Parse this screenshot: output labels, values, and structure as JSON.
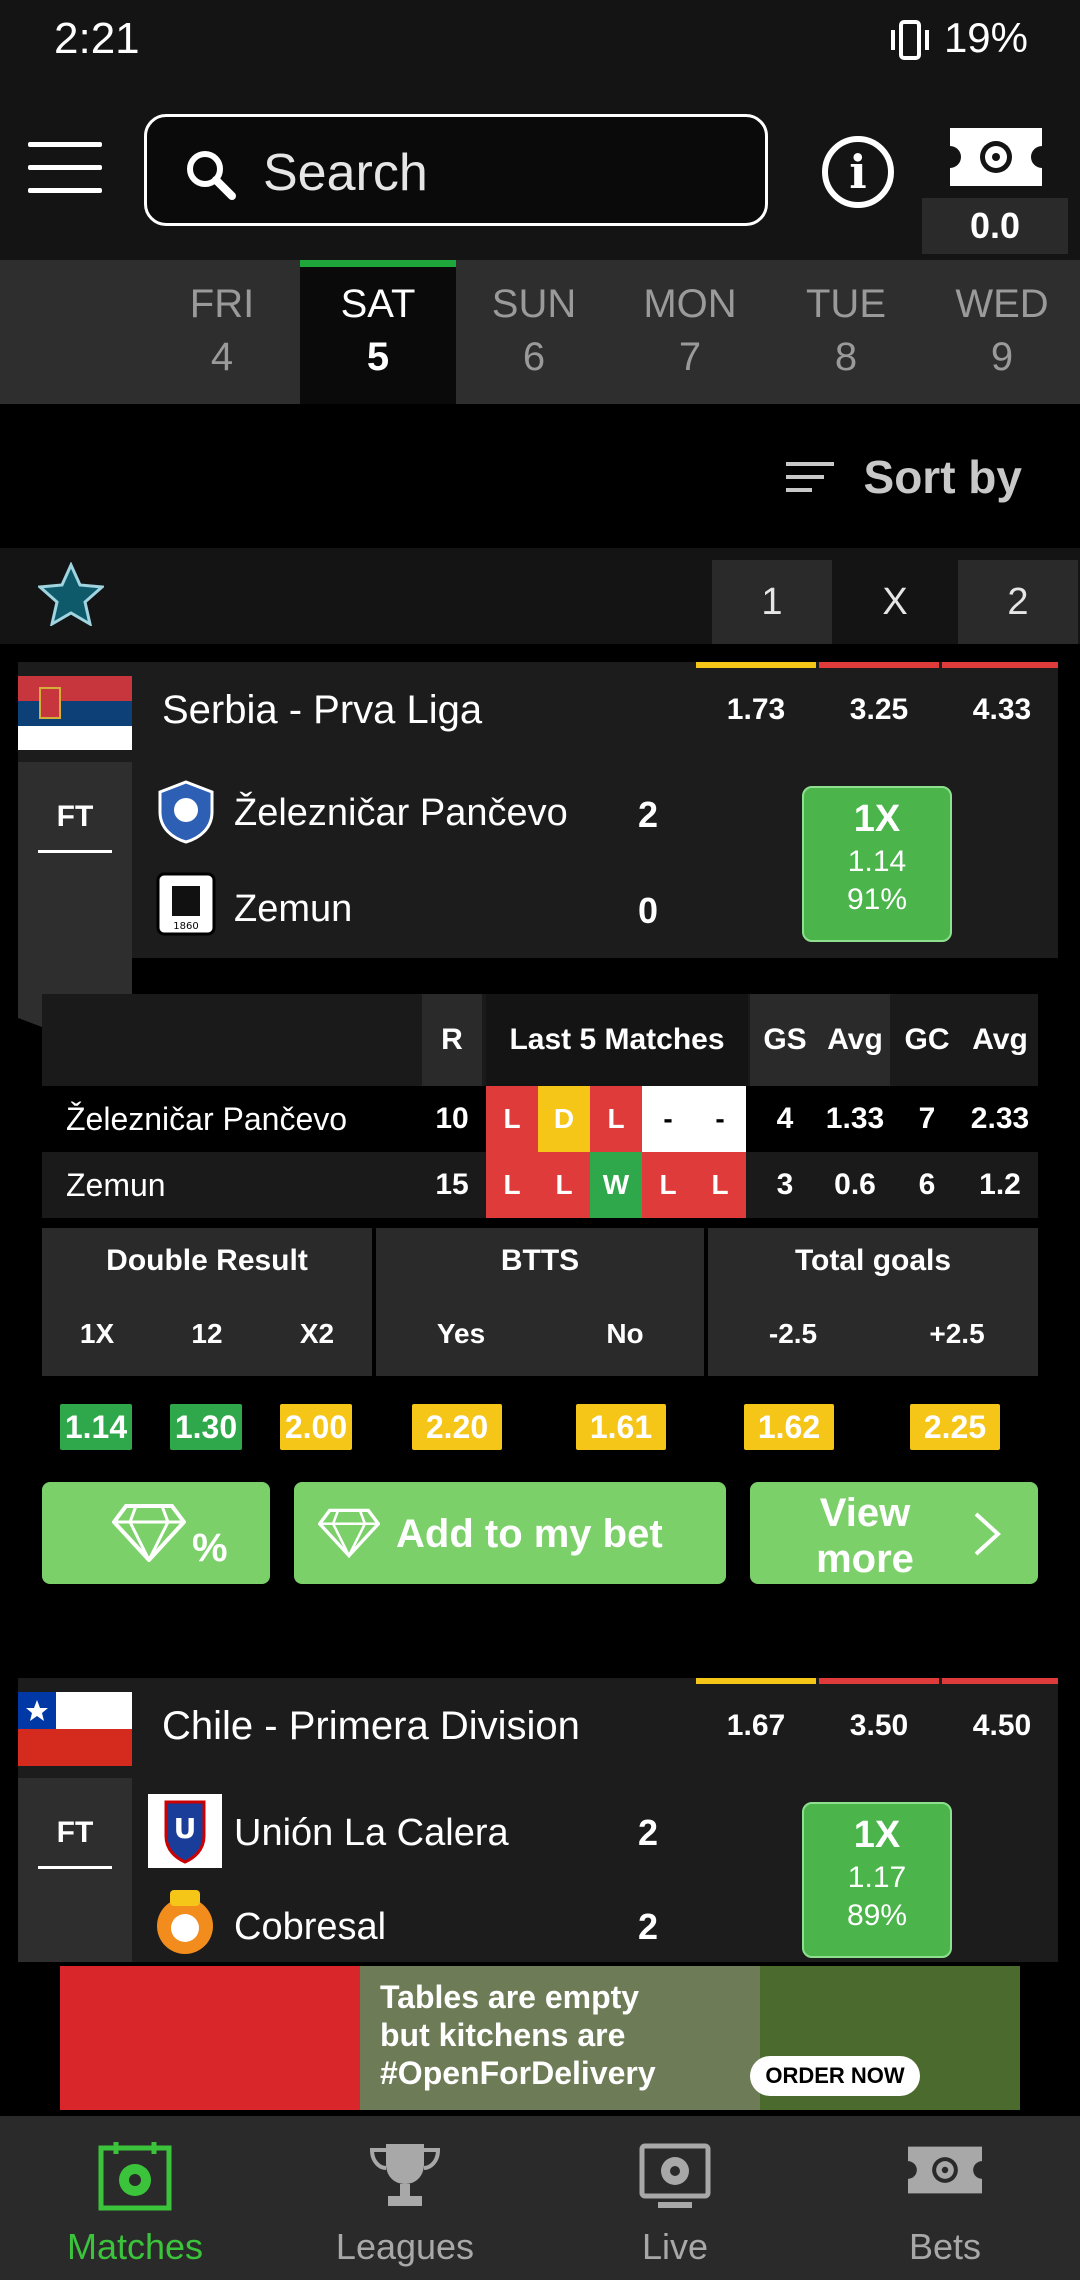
{
  "status": {
    "time": "2:21",
    "battery": "19%"
  },
  "search": {
    "placeholder": "Search"
  },
  "betslip": {
    "count": "0.0"
  },
  "days": [
    {
      "name": "FRI",
      "num": "4"
    },
    {
      "name": "SAT",
      "num": "5"
    },
    {
      "name": "SUN",
      "num": "6"
    },
    {
      "name": "MON",
      "num": "7"
    },
    {
      "name": "TUE",
      "num": "8"
    },
    {
      "name": "WED",
      "num": "9"
    }
  ],
  "sort": {
    "label": "Sort by"
  },
  "header_cols": [
    "1",
    "X",
    "2"
  ],
  "match1": {
    "league": "Serbia - Prva Liga",
    "odds": [
      "1.73",
      "3.25",
      "4.33"
    ],
    "status": "FT",
    "home": {
      "name": "Železničar Pančevo",
      "score": "2"
    },
    "away": {
      "name": "Zemun",
      "score": "0"
    },
    "tip": {
      "pick": "1X",
      "odd": "1.14",
      "pct": "91%"
    },
    "stats": {
      "headers": {
        "r": "R",
        "last5": "Last 5 Matches",
        "gs": "GS",
        "avg1": "Avg",
        "gc": "GC",
        "avg2": "Avg"
      },
      "rows": [
        {
          "team": "Železničar Pančevo",
          "r": "10",
          "form": [
            "L",
            "D",
            "L",
            "-",
            "-"
          ],
          "gs": "4",
          "avg1": "1.33",
          "gc": "7",
          "avg2": "2.33"
        },
        {
          "team": "Zemun",
          "r": "15",
          "form": [
            "L",
            "L",
            "W",
            "L",
            "L"
          ],
          "gs": "3",
          "avg1": "0.6",
          "gc": "6",
          "avg2": "1.2"
        }
      ]
    },
    "markets": {
      "double": {
        "title": "Double Result",
        "subs": [
          "1X",
          "12",
          "X2"
        ],
        "values": [
          "1.14",
          "1.30",
          "2.00"
        ]
      },
      "btts": {
        "title": "BTTS",
        "subs": [
          "Yes",
          "No"
        ],
        "values": [
          "2.20",
          "1.61"
        ]
      },
      "total": {
        "title": "Total goals",
        "subs": [
          "-2.5",
          "+2.5"
        ],
        "values": [
          "1.62",
          "2.25"
        ]
      }
    },
    "buttons": {
      "pct": "%",
      "add": "Add to my bet",
      "view1": "View",
      "view2": "more"
    }
  },
  "match2": {
    "league": "Chile - Primera Division",
    "odds": [
      "1.67",
      "3.50",
      "4.50"
    ],
    "status": "FT",
    "home": {
      "name": "Unión La Calera",
      "score": "2"
    },
    "away": {
      "name": "Cobresal",
      "score": "2"
    },
    "tip": {
      "pick": "1X",
      "odd": "1.17",
      "pct": "89%"
    }
  },
  "banner": {
    "line1": "Tables are empty",
    "line2": "but kitchens are",
    "line3": "#OpenForDelivery",
    "cta": "ORDER NOW"
  },
  "nav": [
    {
      "label": "Matches"
    },
    {
      "label": "Leagues"
    },
    {
      "label": "Live"
    },
    {
      "label": "Bets"
    }
  ],
  "colors": {
    "green": "#1fa63b",
    "loss": "#e03b3b",
    "draw": "#f5c518",
    "win": "#2ea84a",
    "pill_green": "#2ea84a",
    "pill_yellow": "#f5c518"
  }
}
